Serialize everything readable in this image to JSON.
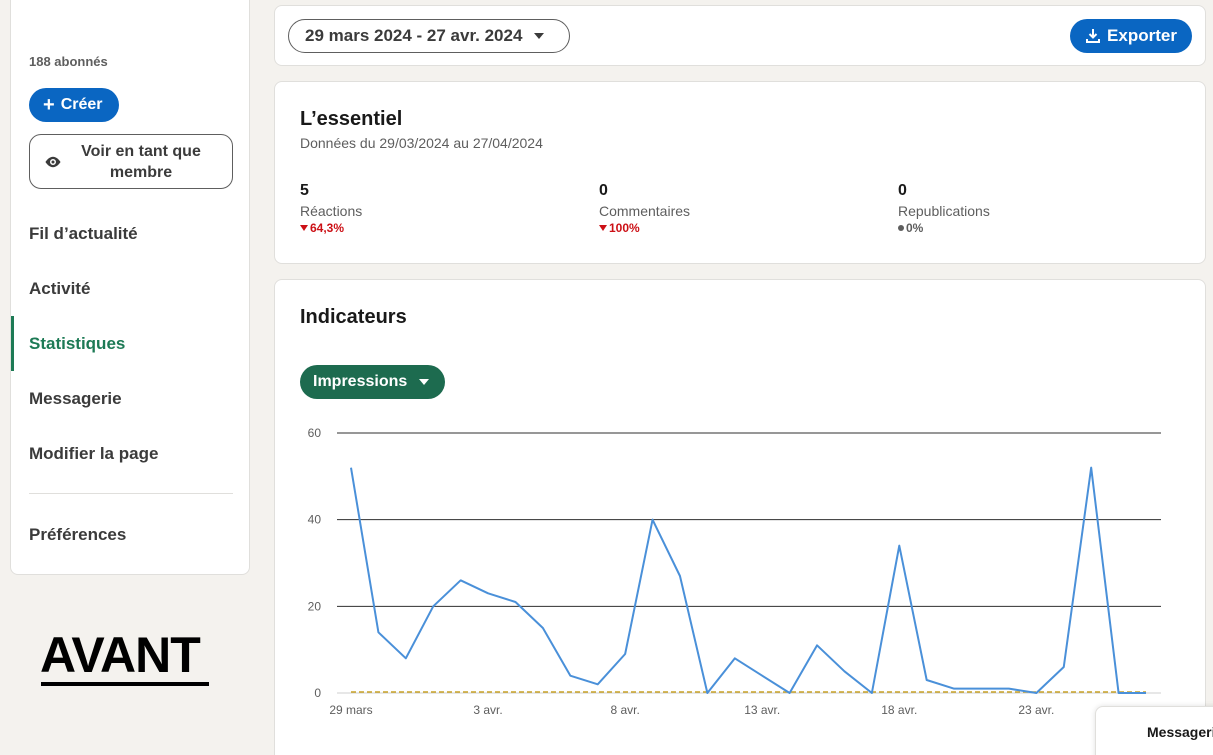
{
  "sidebar": {
    "followers": "188 abonnés",
    "create_label": "Créer",
    "view_as_member_label": "Voir en tant que membre",
    "nav": [
      {
        "label": "Fil d’actualité",
        "active": false
      },
      {
        "label": "Activité",
        "active": false
      },
      {
        "label": "Statistiques",
        "active": true
      },
      {
        "label": "Messagerie",
        "active": false
      },
      {
        "label": "Modifier la page",
        "active": false
      }
    ],
    "preferences_label": "Préférences"
  },
  "overlay": {
    "avant": "AVANT"
  },
  "toolbar": {
    "date_range": "29 mars 2024 - 27 avr. 2024",
    "export_label": "Exporter"
  },
  "essentials": {
    "title": "L’essentiel",
    "subtitle": "Données du 29/03/2024 au 27/04/2024",
    "metrics": [
      {
        "value": "5",
        "label": "Réactions",
        "change": "64,3%",
        "trend": "down"
      },
      {
        "value": "0",
        "label": "Commentaires",
        "change": "100%",
        "trend": "down"
      },
      {
        "value": "0",
        "label": "Republications",
        "change": "0%",
        "trend": "neutral"
      }
    ]
  },
  "indicators": {
    "title": "Indicateurs",
    "metric_selector": "Impressions"
  },
  "messaging": {
    "label": "Messagerie"
  },
  "colors": {
    "accent_blue": "#0a66c2",
    "accent_green": "#1d6b4f",
    "line": "#4a90d9",
    "down": "#cc1016"
  },
  "chart_data": {
    "type": "line",
    "x": [
      "29 mars",
      "30 mars",
      "31 mars",
      "1 avr.",
      "2 avr.",
      "3 avr.",
      "4 avr.",
      "5 avr.",
      "6 avr.",
      "7 avr.",
      "8 avr.",
      "9 avr.",
      "10 avr.",
      "11 avr.",
      "12 avr.",
      "13 avr.",
      "14 avr.",
      "15 avr.",
      "16 avr.",
      "17 avr.",
      "18 avr.",
      "19 avr.",
      "20 avr.",
      "21 avr.",
      "22 avr.",
      "23 avr.",
      "24 avr.",
      "25 avr.",
      "26 avr.",
      "27 avr."
    ],
    "x_tick_labels": [
      "29 mars",
      "3 avr.",
      "8 avr.",
      "13 avr.",
      "18 avr.",
      "23 avr."
    ],
    "x_tick_indices": [
      0,
      5,
      10,
      15,
      20,
      25
    ],
    "series": [
      {
        "values": [
          52,
          14,
          8,
          20,
          26,
          23,
          21,
          15,
          4,
          2,
          9,
          40,
          27,
          0,
          8,
          4,
          0,
          11,
          5,
          0,
          34,
          3,
          1,
          1,
          1,
          0,
          6,
          52,
          0,
          0
        ]
      },
      {
        "values": [
          0,
          0,
          0,
          0,
          0,
          0,
          0,
          0,
          0,
          0,
          0,
          0,
          0,
          0,
          0,
          0,
          0,
          0,
          0,
          0,
          0,
          0,
          0,
          0,
          0,
          0,
          0,
          0,
          0,
          0
        ],
        "style": "dashed"
      }
    ],
    "yticks": [
      0,
      20,
      40,
      60
    ],
    "ylim": [
      0,
      60
    ],
    "grid": true
  }
}
